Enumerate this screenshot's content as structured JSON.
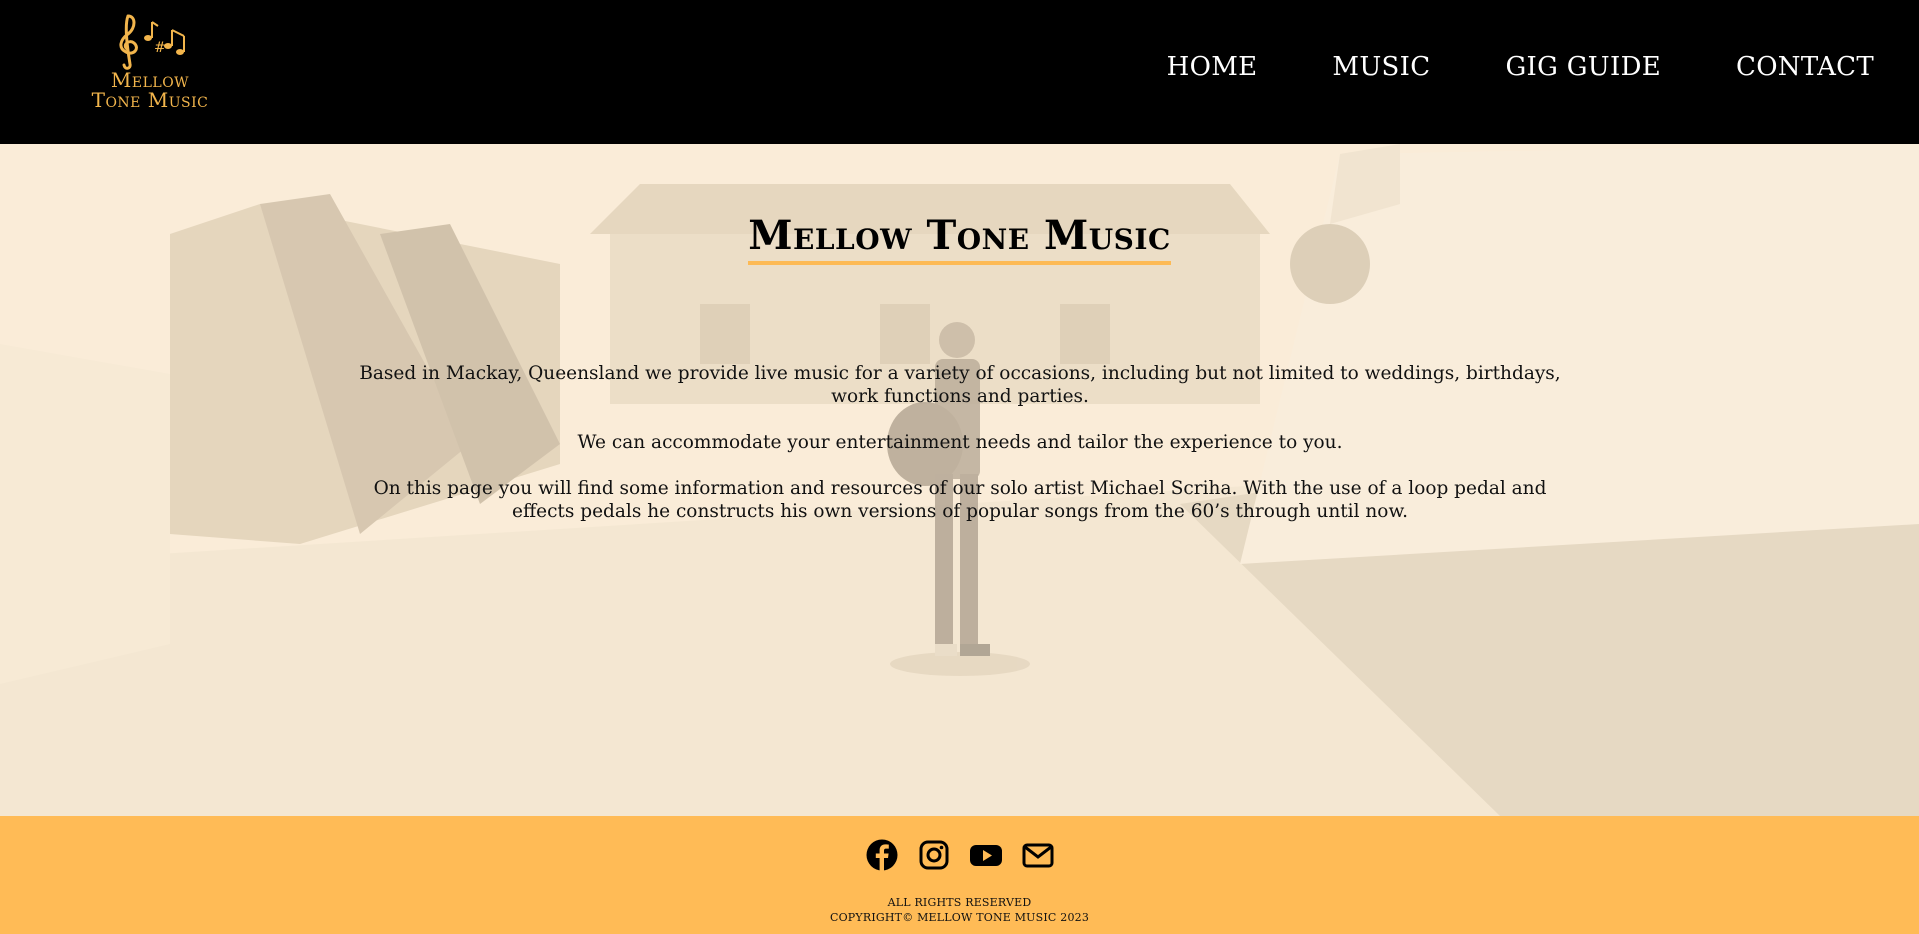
{
  "logo": {
    "line1": "Mellow",
    "line2": "Tone Music"
  },
  "nav": [
    {
      "label": "HOME"
    },
    {
      "label": "MUSIC"
    },
    {
      "label": "GIG GUIDE"
    },
    {
      "label": "CONTACT"
    }
  ],
  "hero": {
    "title": "Mellow Tone Music",
    "paragraphs": [
      "Based in Mackay, Queensland we provide live music for a variety of occasions, including but not limited to weddings, birthdays, work functions and parties.",
      "We can accommodate your entertainment needs and tailor the experience to you.",
      "On this page you will find some information and resources of our solo artist Michael Scriha. With the use of a loop pedal and effects pedals he constructs his own versions of popular songs from the 60’s through until now."
    ]
  },
  "footer": {
    "icons": [
      "facebook-icon",
      "instagram-icon",
      "youtube-icon",
      "envelope-icon"
    ],
    "rights": "ALL RIGHTS RESERVED",
    "copyright": "COPYRIGHT© MELLOW TONE MUSIC 2023"
  },
  "colors": {
    "header_bg": "#000000",
    "accent": "#ffbb56",
    "hero_tint": "#fdf0dc"
  }
}
